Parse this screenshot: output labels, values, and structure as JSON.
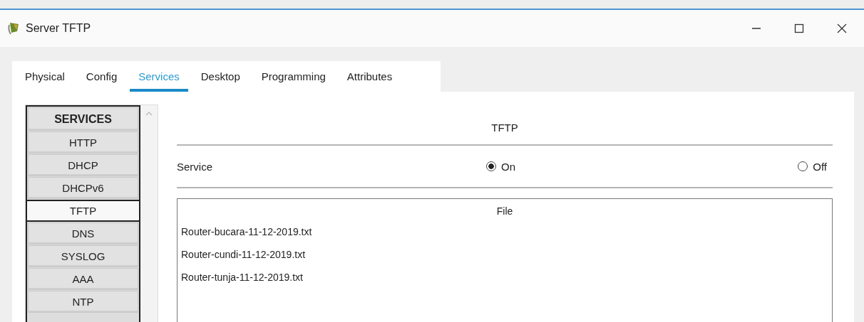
{
  "window": {
    "title": "Server TFTP"
  },
  "tabs": [
    {
      "label": "Physical",
      "selected": false
    },
    {
      "label": "Config",
      "selected": false
    },
    {
      "label": "Services",
      "selected": true
    },
    {
      "label": "Desktop",
      "selected": false
    },
    {
      "label": "Programming",
      "selected": false
    },
    {
      "label": "Attributes",
      "selected": false
    }
  ],
  "sidebar": {
    "header": "SERVICES",
    "items": [
      {
        "label": "HTTP",
        "selected": false
      },
      {
        "label": "DHCP",
        "selected": false
      },
      {
        "label": "DHCPv6",
        "selected": false
      },
      {
        "label": "TFTP",
        "selected": true
      },
      {
        "label": "DNS",
        "selected": false
      },
      {
        "label": "SYSLOG",
        "selected": false
      },
      {
        "label": "AAA",
        "selected": false
      },
      {
        "label": "NTP",
        "selected": false
      }
    ]
  },
  "panel": {
    "title": "TFTP",
    "service_label": "Service",
    "options": [
      {
        "label": "On",
        "selected": true
      },
      {
        "label": "Off",
        "selected": false
      }
    ],
    "file_table": {
      "header": "File",
      "rows": [
        "Router-bucara-11-12-2019.txt",
        "Router-cundi-11-12-2019.txt",
        "Router-tunja-11-12-2019.txt"
      ]
    }
  }
}
